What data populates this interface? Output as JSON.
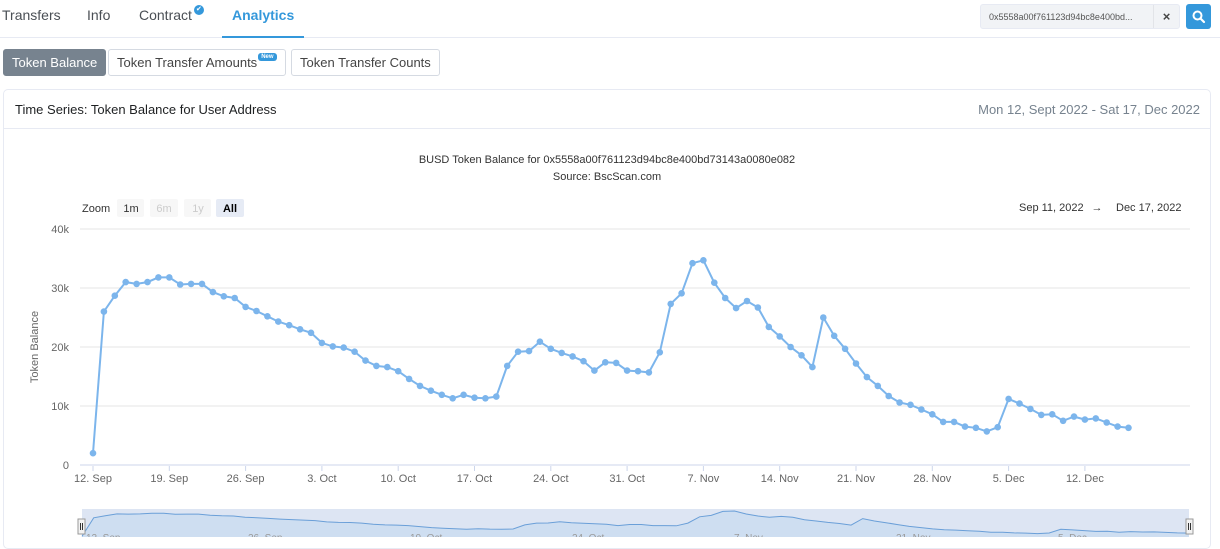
{
  "tabs": [
    {
      "label": "Transfers"
    },
    {
      "label": "Info"
    },
    {
      "label": "Contract"
    },
    {
      "label": "Analytics"
    }
  ],
  "search": {
    "value": "0x5558a00f761123d94bc8e400bd..."
  },
  "subtabs": [
    {
      "label": "Token Balance"
    },
    {
      "label": "Token Transfer Amounts"
    },
    {
      "label": "Token Transfer Counts"
    }
  ],
  "new_badge": "New",
  "card": {
    "title": "Time Series: Token Balance for User Address",
    "date_range": "Mon 12, Sept 2022 - Sat 17, Dec 2022"
  },
  "colors": {
    "accent": "#3498db",
    "series": "#7cb5ec",
    "navigator_fill": "#dde5f3"
  },
  "chart_data": {
    "type": "line",
    "title": "BUSD Token Balance for 0x5558a00f761123d94bc8e400bd73143a0080e082",
    "subtitle": "Source: BscScan.com",
    "ylabel": "Token Balance",
    "ylim": [
      0,
      40000
    ],
    "yticks": [
      "0",
      "10k",
      "20k",
      "30k",
      "40k"
    ],
    "xticks": [
      "12. Sep",
      "19. Sep",
      "26. Sep",
      "3. Oct",
      "10. Oct",
      "17. Oct",
      "24. Oct",
      "31. Oct",
      "7. Nov",
      "14. Nov",
      "21. Nov",
      "28. Nov",
      "5. Dec",
      "12. Dec"
    ],
    "zoom": {
      "label": "Zoom",
      "buttons": [
        "1m",
        "6m",
        "1y",
        "All"
      ],
      "selected": "All"
    },
    "range_from": "Sep 11, 2022",
    "range_arrow": "→",
    "range_to": "Dec 17, 2022",
    "navigator_ticks": [
      "12. Sep",
      "26. Sep",
      "10. Oct",
      "24. Oct",
      "7. Nov",
      "21. Nov",
      "5. Dec"
    ],
    "grid": true,
    "series": [
      {
        "values": [
          2000,
          26000,
          28700,
          31000,
          30700,
          31000,
          31800,
          31800,
          30600,
          30700,
          30700,
          29300,
          28600,
          28300,
          26800,
          26100,
          25200,
          24300,
          23700,
          23000,
          22400,
          20700,
          20100,
          19900,
          19200,
          17700,
          16800,
          16600,
          15900,
          14600,
          13400,
          12600,
          11900,
          11300,
          11900,
          11400,
          11300,
          11600,
          16800,
          19200,
          19300,
          20900,
          19700,
          19000,
          18400,
          17600,
          16000,
          17400,
          17300,
          16000,
          15900,
          15700,
          19100,
          27300,
          29100,
          34200,
          34700,
          30900,
          28300,
          26600,
          27800,
          26700,
          23400,
          21800,
          20000,
          18600,
          16600,
          25000,
          21900,
          19700,
          17200,
          14900,
          13400,
          11700,
          10600,
          10200,
          9400,
          8600,
          7300,
          7300,
          6500,
          6300,
          5700,
          6400,
          11200,
          10400,
          9500,
          8500,
          8600,
          7500,
          8200,
          7700,
          7900,
          7200,
          6500,
          6300
        ]
      }
    ]
  }
}
